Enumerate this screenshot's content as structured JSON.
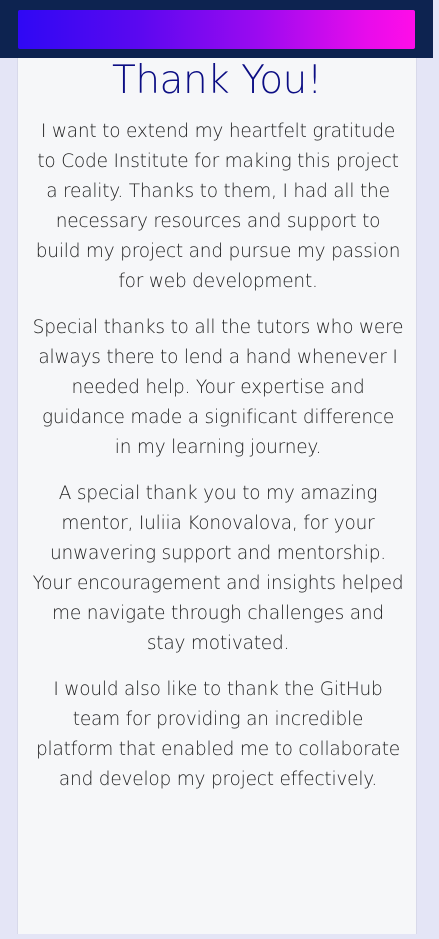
{
  "page": {
    "title": "Thank You!",
    "paragraphs": [
      "I want to extend my heartfelt gratitude to Code Institute for making this project a reality. Thanks to them, I had all the necessary resources and support to build my project and pursue my passion for web development.",
      "Special thanks to all the tutors who were always there to lend a hand whenever I needed help. Your expertise and guidance made a significant difference in my learning journey.",
      "A special thank you to my amazing mentor, Iuliia Konovalova, for your unwavering support and mentorship. Your encouragement and insights helped me navigate through challenges and stay motivated.",
      "I would also like to thank the GitHub team for providing an incredible platform that enabled me to collaborate and develop my project effectively."
    ]
  },
  "colors": {
    "header_background": "#0d2350",
    "gradient_start": "#2f08f4",
    "gradient_end": "#ff0de8",
    "title_color": "#0c0e84",
    "page_background": "#e4e5f6",
    "card_background": "#f6f7f9"
  }
}
